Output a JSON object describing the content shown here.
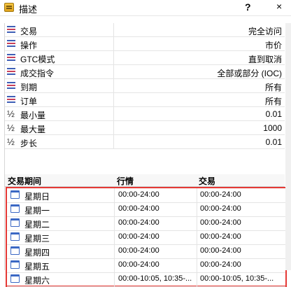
{
  "window": {
    "title": "描述",
    "help": "?",
    "close": "×"
  },
  "properties": [
    {
      "icon": "lines-icon",
      "label": "交易",
      "value": "完全访问"
    },
    {
      "icon": "lines-icon",
      "label": "操作",
      "value": "市价"
    },
    {
      "icon": "lines-icon",
      "label": "GTC模式",
      "value": "直到取消"
    },
    {
      "icon": "lines-icon",
      "label": "成交指令",
      "value": "全部或部分 (IOC)"
    },
    {
      "icon": "lines-icon",
      "label": "到期",
      "value": "所有"
    },
    {
      "icon": "lines-icon",
      "label": "订单",
      "value": "所有"
    },
    {
      "icon": "half-icon",
      "label": "最小量",
      "value": "0.01"
    },
    {
      "icon": "half-icon",
      "label": "最大量",
      "value": "1000"
    },
    {
      "icon": "half-icon",
      "label": "步长",
      "value": "0.01"
    }
  ],
  "half_glyph": "½",
  "sessions_header": {
    "col1": "交易期间",
    "col2": "行情",
    "col3": "交易"
  },
  "sessions": [
    {
      "day": "星期日",
      "quotes": "00:00-24:00",
      "trade": "00:00-24:00"
    },
    {
      "day": "星期一",
      "quotes": "00:00-24:00",
      "trade": "00:00-24:00"
    },
    {
      "day": "星期二",
      "quotes": "00:00-24:00",
      "trade": "00:00-24:00"
    },
    {
      "day": "星期三",
      "quotes": "00:00-24:00",
      "trade": "00:00-24:00"
    },
    {
      "day": "星期四",
      "quotes": "00:00-24:00",
      "trade": "00:00-24:00"
    },
    {
      "day": "星期五",
      "quotes": "00:00-24:00",
      "trade": "00:00-24:00"
    },
    {
      "day": "星期六",
      "quotes": "00:00-10:05, 10:35-...",
      "trade": "00:00-10:05, 10:35-..."
    }
  ],
  "colors": {
    "highlight": "#e53935",
    "icon_blue": "#3f5fb6"
  }
}
